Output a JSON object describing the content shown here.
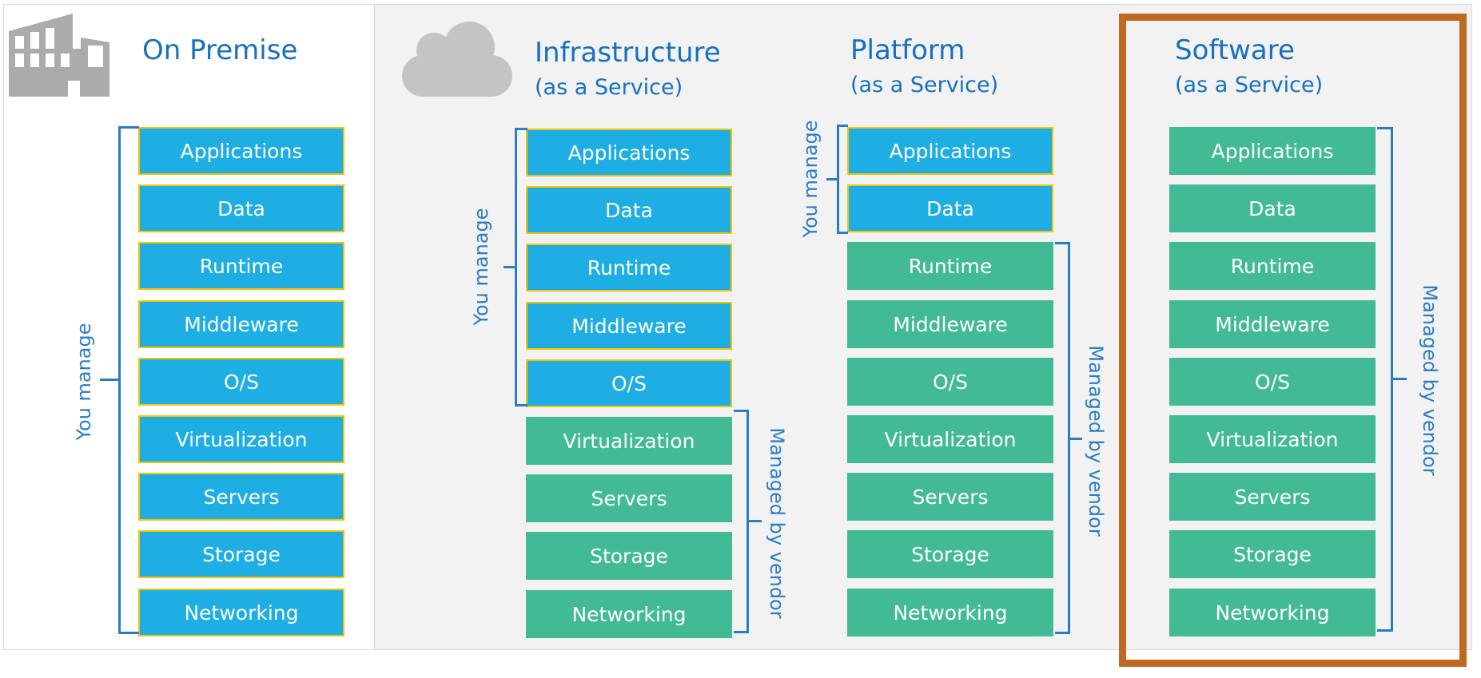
{
  "colors": {
    "title": "#1770bf",
    "you_manage_fill": "#1eaee3",
    "you_manage_border": "#f5c400",
    "vendor_fill": "#43ba96",
    "bracket": "#2a7dc5",
    "highlight": "#bf6a20",
    "icon": "#ababab"
  },
  "layers": [
    "Applications",
    "Data",
    "Runtime",
    "Middleware",
    "O/S",
    "Virtualization",
    "Servers",
    "Storage",
    "Networking"
  ],
  "columns": [
    {
      "id": "on-premise",
      "icon": "building-icon",
      "title": "On Premise",
      "subtitle": "",
      "you_manage_count": 9,
      "you_manage_label": "You manage",
      "vendor_label": ""
    },
    {
      "id": "iaas",
      "icon": "cloud-icon",
      "title": "Infrastructure",
      "subtitle": "(as a Service)",
      "you_manage_count": 5,
      "you_manage_label": "You manage",
      "vendor_label": "Managed by vendor"
    },
    {
      "id": "paas",
      "icon": "",
      "title": "Platform",
      "subtitle": "(as a Service)",
      "you_manage_count": 2,
      "you_manage_label": "You manage",
      "vendor_label": "Managed by vendor"
    },
    {
      "id": "saas",
      "icon": "",
      "title": "Software",
      "subtitle": "(as a Service)",
      "you_manage_count": 0,
      "you_manage_label": "",
      "vendor_label": "Managed by vendor",
      "highlighted": true
    }
  ]
}
